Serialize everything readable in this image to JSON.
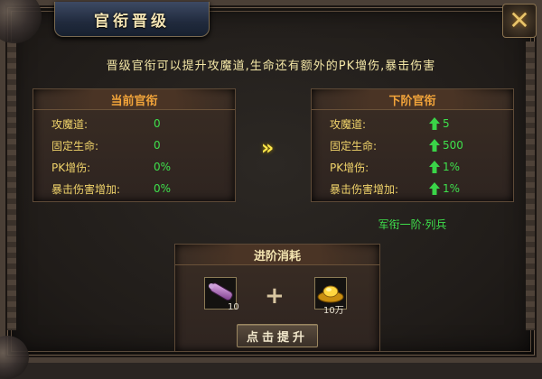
{
  "window": {
    "title": "官衔晋级"
  },
  "description": "晋级官衔可以提升攻魔道,生命还有额外的PK增伤,暴击伤害",
  "current_rank": {
    "header": "当前官衔",
    "stats": [
      {
        "label": "攻魔道:",
        "value": "0"
      },
      {
        "label": "固定生命:",
        "value": "0"
      },
      {
        "label": "PK增伤:",
        "value": "0%"
      },
      {
        "label": "暴击伤害增加:",
        "value": "0%"
      }
    ]
  },
  "next_rank": {
    "header": "下阶官衔",
    "stats": [
      {
        "label": "攻魔道:",
        "value": "5"
      },
      {
        "label": "固定生命:",
        "value": "500"
      },
      {
        "label": "PK增伤:",
        "value": "1%"
      },
      {
        "label": "暴击伤害增加:",
        "value": "1%"
      }
    ],
    "rank_name": "军衔一阶·列兵"
  },
  "cost": {
    "header": "进阶消耗",
    "items": [
      {
        "icon": "scroll-item-icon",
        "quantity": "10"
      },
      {
        "icon": "gold-ingot-icon",
        "quantity": "10万"
      }
    ],
    "button_label": "点击提升"
  },
  "colors": {
    "label": "#f0d36a",
    "value_green": "#3ee04c",
    "header_orange": "#f2a43a",
    "arrow_yellow": "#ffe84a"
  }
}
